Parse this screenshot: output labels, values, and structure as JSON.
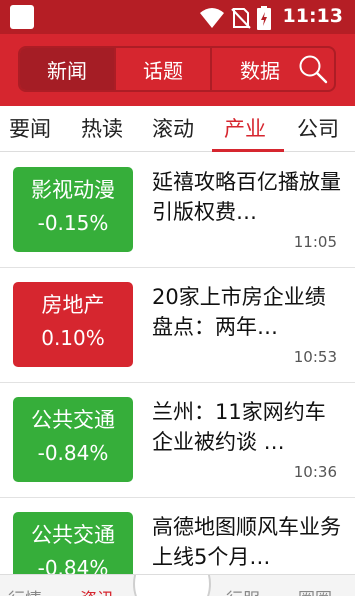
{
  "status": {
    "time": "11:13"
  },
  "header": {
    "segments": [
      {
        "label": "新闻",
        "active": true
      },
      {
        "label": "话题",
        "active": false
      },
      {
        "label": "数据",
        "active": false
      }
    ],
    "search_icon": "search-icon"
  },
  "categories": {
    "tabs": [
      "要闻",
      "热读",
      "滚动",
      "产业",
      "公司"
    ],
    "active": "产业"
  },
  "news": [
    {
      "tag": "影视动漫",
      "change": "-0.15%",
      "tag_color": "#36ae3a",
      "title": "延禧攻略百亿播放量引版权费…",
      "time": "11:05"
    },
    {
      "tag": "房地产",
      "change": "0.10%",
      "tag_color": "#d6262f",
      "title": "20家上市房企业绩盘点：两年…",
      "time": "10:53"
    },
    {
      "tag": "公共交通",
      "change": "-0.84%",
      "tag_color": "#36ae3a",
      "title": "兰州：11家网约车企业被约谈 …",
      "time": "10:36"
    },
    {
      "tag": "公共交通",
      "change": "-0.84%",
      "tag_color": "#36ae3a",
      "title": "高德地图顺风车业务上线5个月…",
      "time": ""
    }
  ],
  "bottom_nav": {
    "items": [
      "行情",
      "资讯",
      "行服",
      "圈圈"
    ]
  }
}
